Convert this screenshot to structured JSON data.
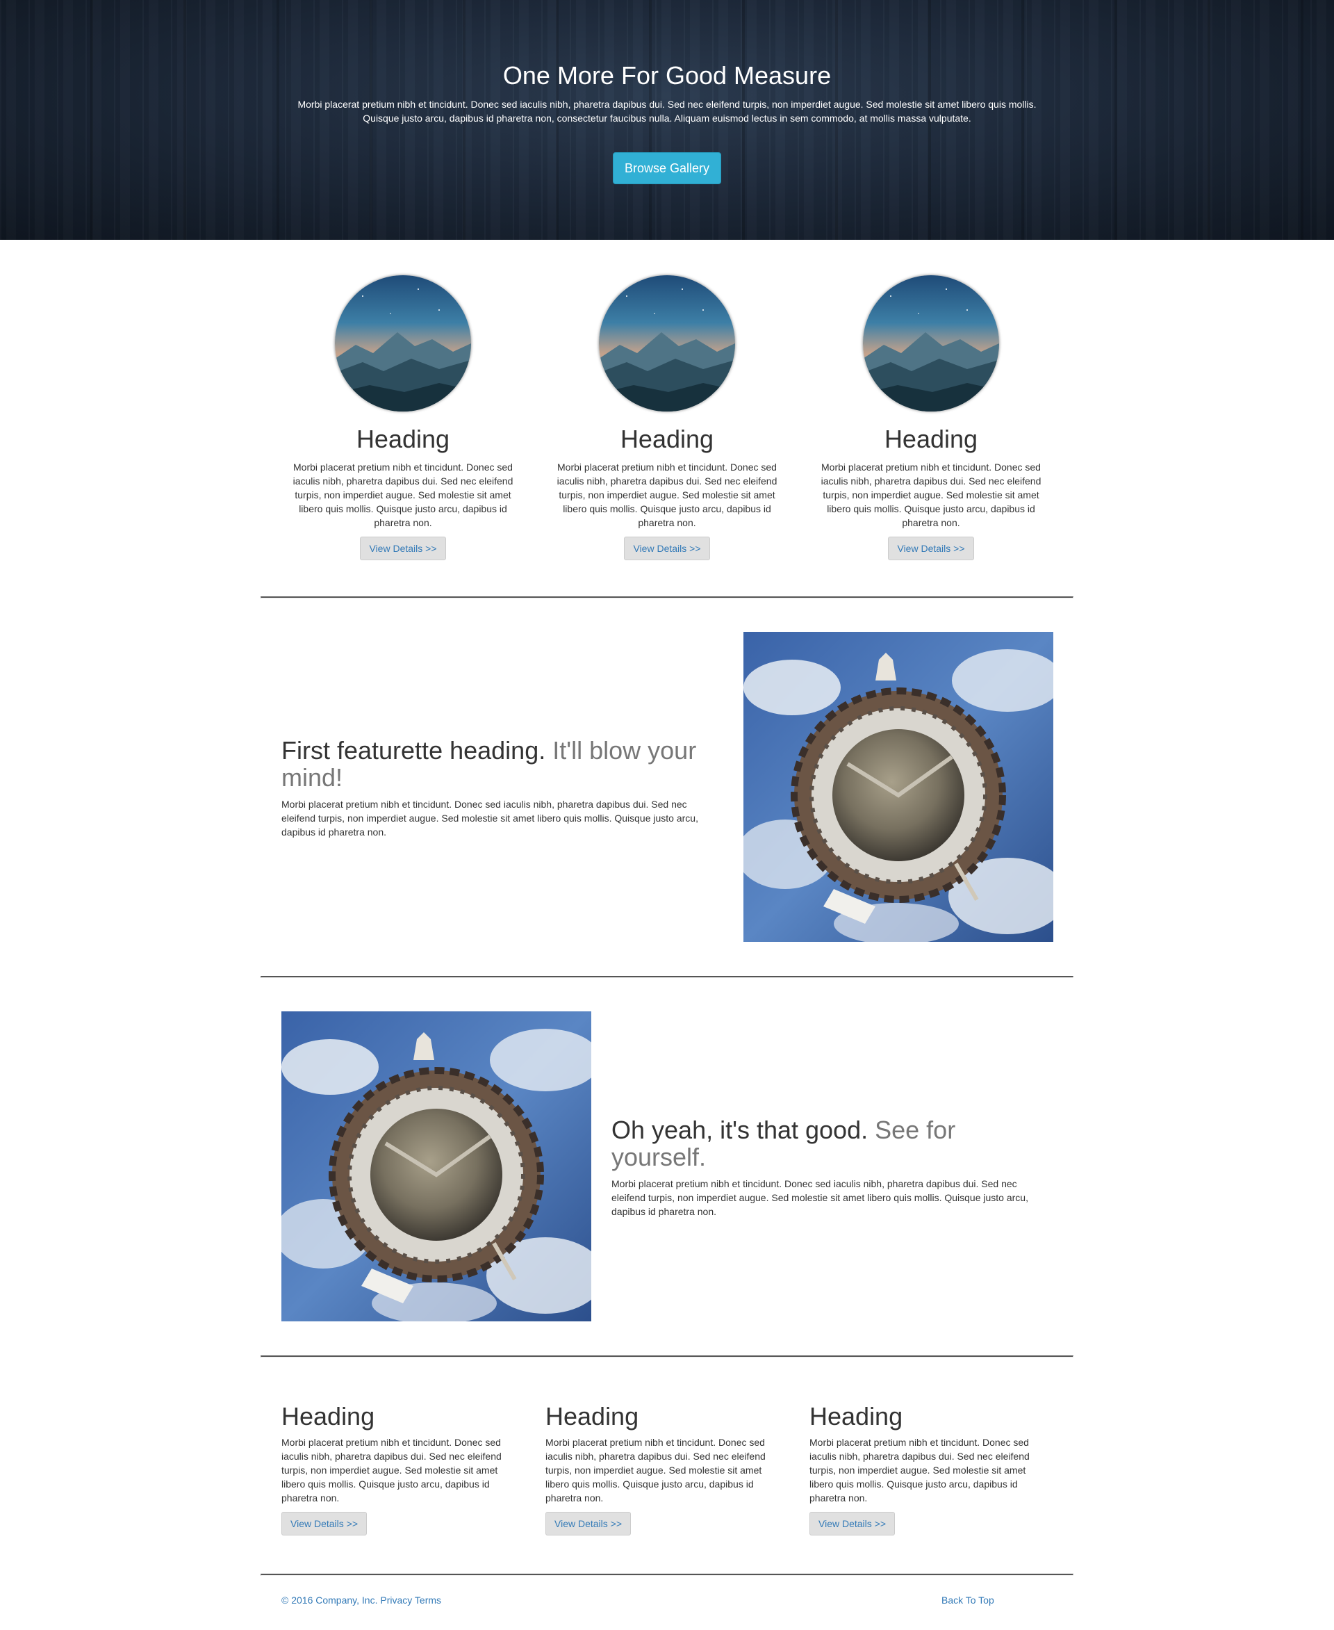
{
  "hero": {
    "title": "One More For Good Measure",
    "text": "Morbi placerat pretium nibh et tincidunt. Donec sed iaculis nibh, pharetra dapibus dui. Sed nec eleifend turpis, non imperdiet augue. Sed molestie sit amet libero quis mollis. Quisque justo arcu, dapibus id pharetra non, consectetur faucibus nulla. Aliquam euismod lectus in sem commodo, at mollis massa vulputate.",
    "button": "Browse Gallery"
  },
  "circle_columns": [
    {
      "heading": "Heading",
      "text": "Morbi placerat pretium nibh et tincidunt. Donec sed iaculis nibh, pharetra dapibus dui. Sed nec eleifend turpis, non imperdiet augue. Sed molestie sit amet libero quis mollis. Quisque justo arcu, dapibus id pharetra non.",
      "button": "View Details >>"
    },
    {
      "heading": "Heading",
      "text": "Morbi placerat pretium nibh et tincidunt. Donec sed iaculis nibh, pharetra dapibus dui. Sed nec eleifend turpis, non imperdiet augue. Sed molestie sit amet libero quis mollis. Quisque justo arcu, dapibus id pharetra non.",
      "button": "View Details >>"
    },
    {
      "heading": "Heading",
      "text": "Morbi placerat pretium nibh et tincidunt. Donec sed iaculis nibh, pharetra dapibus dui. Sed nec eleifend turpis, non imperdiet augue. Sed molestie sit amet libero quis mollis. Quisque justo arcu, dapibus id pharetra non.",
      "button": "View Details >>"
    }
  ],
  "featurettes": [
    {
      "heading": "First featurette heading.",
      "muted": "It'll blow your mind!",
      "text": "Morbi placerat pretium nibh et tincidunt. Donec sed iaculis nibh, pharetra dapibus dui. Sed nec eleifend turpis, non imperdiet augue. Sed molestie sit amet libero quis mollis. Quisque justo arcu, dapibus id pharetra non."
    },
    {
      "heading": "Oh yeah, it's that good.",
      "muted": "See for yourself.",
      "text": "Morbi placerat pretium nibh et tincidunt. Donec sed iaculis nibh, pharetra dapibus dui. Sed nec eleifend turpis, non imperdiet augue. Sed molestie sit amet libero quis mollis. Quisque justo arcu, dapibus id pharetra non."
    }
  ],
  "bottom_columns": [
    {
      "heading": "Heading",
      "text": "Morbi placerat pretium nibh et tincidunt. Donec sed iaculis nibh, pharetra dapibus dui. Sed nec eleifend turpis, non imperdiet augue. Sed molestie sit amet libero quis mollis. Quisque justo arcu, dapibus id pharetra non.",
      "button": "View Details >>"
    },
    {
      "heading": "Heading",
      "text": "Morbi placerat pretium nibh et tincidunt. Donec sed iaculis nibh, pharetra dapibus dui. Sed nec eleifend turpis, non imperdiet augue. Sed molestie sit amet libero quis mollis. Quisque justo arcu, dapibus id pharetra non.",
      "button": "View Details >>"
    },
    {
      "heading": "Heading",
      "text": "Morbi placerat pretium nibh et tincidunt. Donec sed iaculis nibh, pharetra dapibus dui. Sed nec eleifend turpis, non imperdiet augue. Sed molestie sit amet libero quis mollis. Quisque justo arcu, dapibus id pharetra non.",
      "button": "View Details >>"
    }
  ],
  "footer": {
    "copyright": "© 2016 Company, Inc.",
    "privacy": "Privacy",
    "terms": "Terms",
    "back_to_top": "Back To Top"
  },
  "colors": {
    "hero_bg": "#1b2636",
    "info_button": "#31b0d5",
    "link": "#337ab7",
    "muted_heading": "#777777"
  }
}
